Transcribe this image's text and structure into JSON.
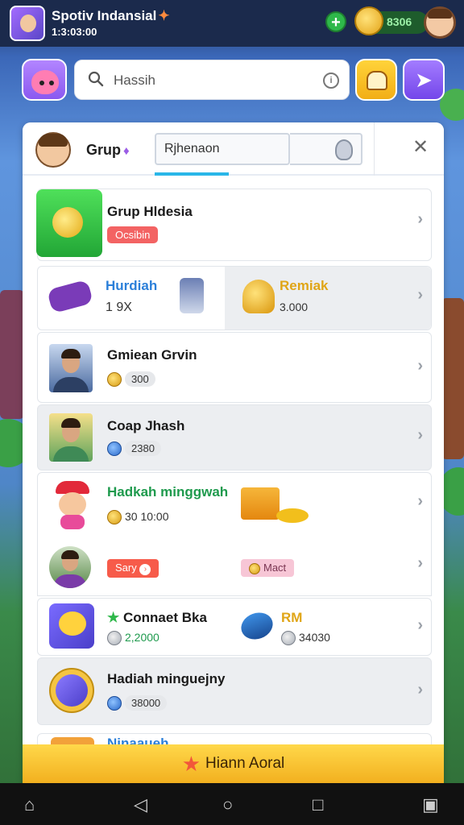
{
  "header": {
    "app_title": "Spotiv Indansial",
    "app_subtitle": "1:3:03:00",
    "coins": "8306"
  },
  "search": {
    "value": "Hassih"
  },
  "panel": {
    "group_label": "Grup",
    "tab_value": "Rjhenaon"
  },
  "rows": [
    {
      "title": "Grup Hldesia",
      "badge": "Ocsibin"
    },
    {
      "left_title": "Hurdiah",
      "left_sub": "1 9X",
      "right_title": "Remiak",
      "right_sub": "3.000"
    },
    {
      "title": "Gmiean Grvin",
      "value": "300"
    },
    {
      "title": "Coap Jhash",
      "value": "2380"
    },
    {
      "title": "Hadkah minggwah",
      "value": "30 10:00"
    },
    {
      "left_tag": "Sary",
      "right_tag": "Mact"
    },
    {
      "left_title": "Connaet Bka",
      "left_sub": "2,2000",
      "right_title": "RM",
      "right_sub": "34030"
    },
    {
      "title": "Hadiah minguejny",
      "value": "38000"
    }
  ],
  "partial_row_title": "Ninaaueh",
  "cta": {
    "label": "Hiann Aoral"
  },
  "colors": {
    "accent_yellow": "#f2b01f",
    "accent_purple": "#8b59f0",
    "green": "#2eb84a",
    "red": "#f36363"
  }
}
